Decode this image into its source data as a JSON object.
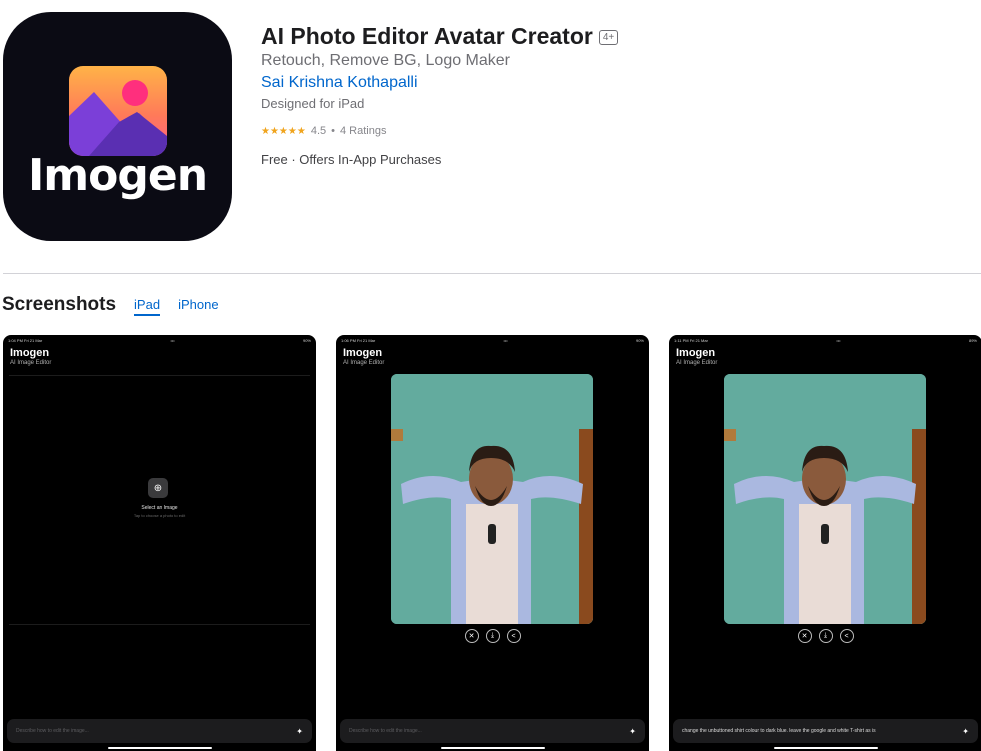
{
  "app": {
    "icon_wordmark": "Imogen",
    "title": "AI Photo Editor Avatar Creator",
    "age_rating": "4+",
    "subtitle": "Retouch, Remove BG, Logo Maker",
    "developer": "Sai Krishna Kothapalli",
    "designed_for": "Designed for iPad",
    "rating": {
      "stars": "★★★★★",
      "score": "4.5",
      "separator": "•",
      "count": "4 Ratings"
    },
    "price": "Free · Offers In-App Purchases"
  },
  "screenshots": {
    "heading": "Screenshots",
    "tabs": [
      {
        "label": "iPad",
        "active": true
      },
      {
        "label": "iPhone",
        "active": false
      }
    ],
    "items": [
      {
        "status_time": "1:04 PM  Fri 21 Mar",
        "status_dots": "•••",
        "status_right": "90%",
        "app_name": "Imogen",
        "app_tagline": "AI Image Editor",
        "empty_title": "Select an Image",
        "empty_hint": "Tap to choose a photo to edit",
        "prompt": "Describe how to edit the image..."
      },
      {
        "status_time": "1:06 PM  Fri 21 Mar",
        "status_dots": "•••",
        "status_right": "90%",
        "app_name": "Imogen",
        "app_tagline": "AI Image Editor",
        "prompt": "Describe how to edit the image..."
      },
      {
        "status_time": "1:11 PM  Fri 21 Mar",
        "status_dots": "•••",
        "status_right": "89%",
        "app_name": "Imogen",
        "app_tagline": "AI Image Editor",
        "prompt": "change the unbuttoned shirt colour to dark blue. leave the google and white T-shirt as is"
      }
    ]
  },
  "colors": {
    "accent": "#0066cc",
    "star": "#f0a41d",
    "icon_bg": "#0b0b14",
    "shot_bg": "#000000"
  }
}
